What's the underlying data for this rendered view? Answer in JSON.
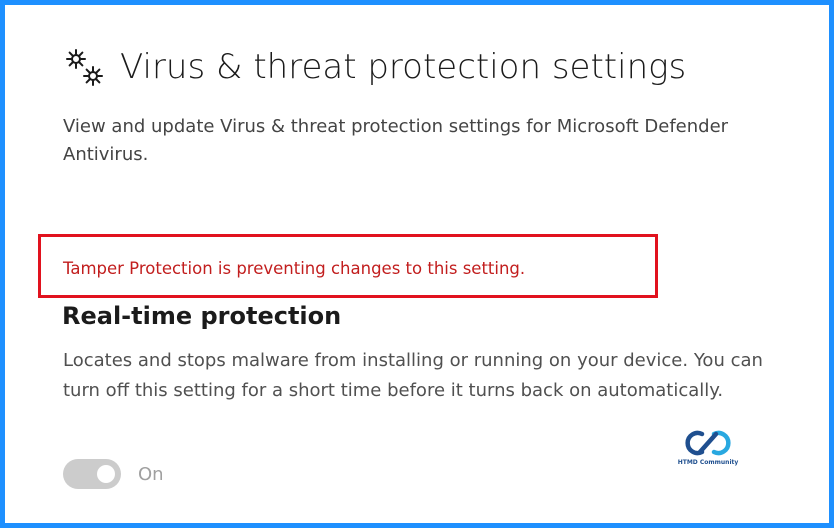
{
  "header": {
    "icon": "gears-icon",
    "title": "Virus & threat protection settings",
    "description": "View and update Virus & threat protection settings for Microsoft Defender Antivirus."
  },
  "tamper_notice": {
    "text": "Tamper Protection is preventing changes to this setting.",
    "color": "#c21e1e",
    "highlight_border_color": "#e1121e"
  },
  "realtime": {
    "heading": "Real-time protection",
    "description": "Locates and stops malware from installing or running on your device. You can turn off this setting for a short time before it turns back on automatically.",
    "toggle": {
      "state": "on",
      "disabled": true,
      "label": "On"
    }
  },
  "watermark": {
    "logo": "htmd-logo",
    "text": "HTMD Community"
  },
  "colors": {
    "frame": "#1e90ff",
    "background": "#ffffff",
    "toggle_disabled": "#cccccc"
  }
}
